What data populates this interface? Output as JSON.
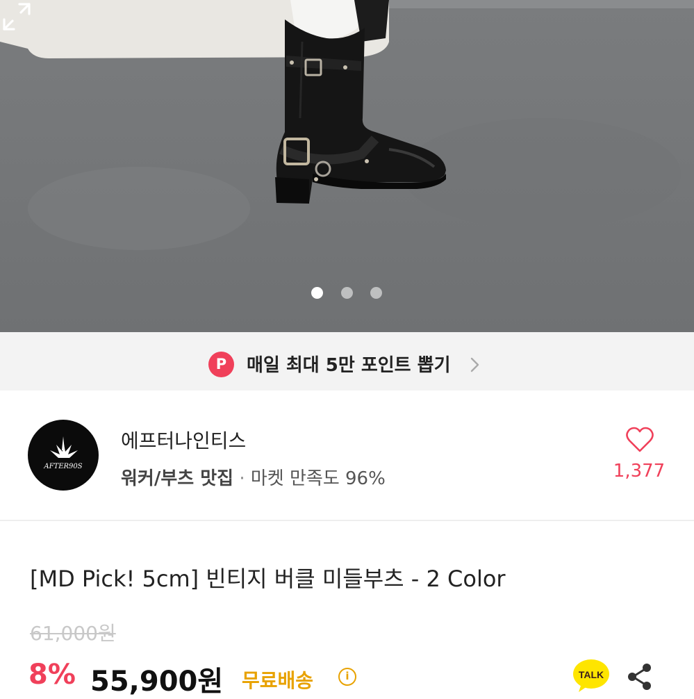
{
  "carousel": {
    "total_images": 3,
    "active_index": 0
  },
  "promo": {
    "badge_letter": "P",
    "text": "매일 최대 5만 포인트 뽑기",
    "badge_color": "#f0405a"
  },
  "seller": {
    "logo_text": "AFTER90S",
    "name": "에프터나인티스",
    "tag": "워커/부츠 맛집",
    "separator": " · ",
    "satisfaction": "마켓 만족도 96%",
    "likes": "1,377"
  },
  "product": {
    "title": "[MD Pick! 5cm] 빈티지 버클 미들부츠 - 2 Color",
    "original_price": "61,000원",
    "discount": "8%",
    "price": "55,900원",
    "shipping": "무료배송",
    "info_icon": "i"
  },
  "actions": {
    "kakao_label": "TALK"
  },
  "colors": {
    "accent_red": "#f0405a",
    "shipping_gold": "#e8a200",
    "kakao_yellow": "#fee500"
  },
  "icons": [
    "expand-icon",
    "chevron-right-icon",
    "heart-icon",
    "info-icon",
    "kakaotalk-icon",
    "share-icon"
  ]
}
